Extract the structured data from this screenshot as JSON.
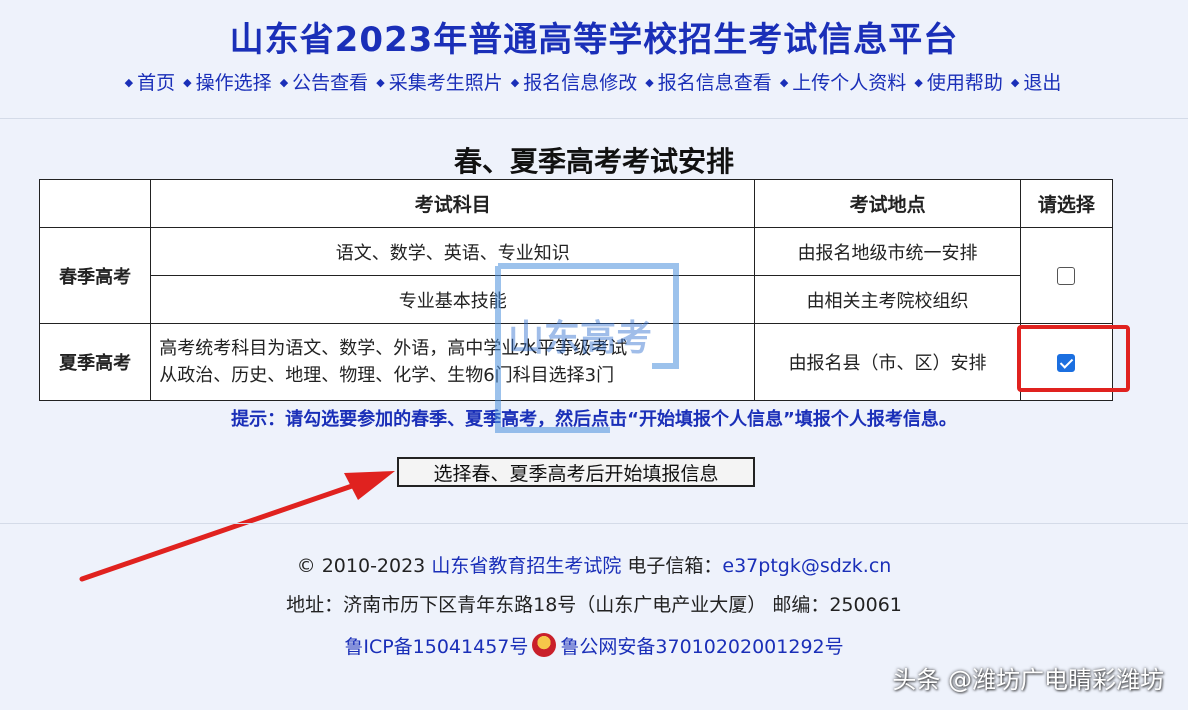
{
  "header": {
    "title": "山东省2023年普通高等学校招生考试信息平台",
    "nav": [
      {
        "label": "首页",
        "name": "nav-home"
      },
      {
        "label": "操作选择",
        "name": "nav-operation-select"
      },
      {
        "label": "公告查看",
        "name": "nav-announcements"
      },
      {
        "label": "采集考生照片",
        "name": "nav-collect-photo"
      },
      {
        "label": "报名信息修改",
        "name": "nav-edit-registration"
      },
      {
        "label": "报名信息查看",
        "name": "nav-view-registration"
      },
      {
        "label": "上传个人资料",
        "name": "nav-upload-documents"
      },
      {
        "label": "使用帮助",
        "name": "nav-help"
      },
      {
        "label": "退出",
        "name": "nav-logout"
      }
    ]
  },
  "main": {
    "title": "春、夏季高考考试安排",
    "table": {
      "headers": {
        "subject": "考试科目",
        "location": "考试地点",
        "select": "请选择"
      },
      "spring": {
        "label": "春季高考",
        "row1_subject": "语文、数学、英语、专业知识",
        "row1_location": "由报名地级市统一安排",
        "row2_subject": "专业基本技能",
        "row2_location": "由相关主考院校组织",
        "checked": false
      },
      "summer": {
        "label": "夏季高考",
        "subject_line1": "高考统考科目为语文、数学、外语，高中学业水平等级考试",
        "subject_line2": "从政治、历史、地理、物理、化学、生物6门科目选择3门",
        "location": "由报名县（市、区）安排",
        "checked": true
      }
    },
    "tip": "提示：请勾选要参加的春季、夏季高考，然后点击“开始填报个人信息”填报个人报考信息。",
    "start_button": "选择春、夏季高考后开始填报信息"
  },
  "footer": {
    "copyright_prefix": "© 2010-2023",
    "org": "山东省教育招生考试院",
    "email_label": "电子信箱：",
    "email": "e37ptgk@sdzk.cn",
    "address": "地址：济南市历下区青年东路18号（山东广电产业大厦） 邮编：250061",
    "icp": "鲁ICP备15041457号",
    "police_record": "鲁公网安备37010202001292号"
  },
  "overlay": {
    "watermark_text": "山东高考",
    "credit": "头条 @潍坊广电睛彩潍坊",
    "accent_red": "#e0221f",
    "accent_blue": "#1a2fb8",
    "checkbox_blue": "#1b6fe0"
  }
}
